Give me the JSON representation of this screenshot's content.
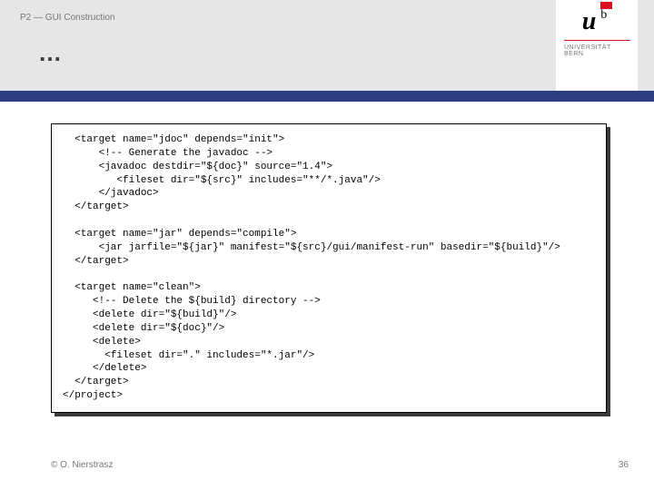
{
  "header": {
    "breadcrumb": "P2 — GUI Construction",
    "title": "…"
  },
  "logo": {
    "u": "u",
    "b": "b",
    "line1": "UNIVERSITÄT",
    "line2": "BERN"
  },
  "code": {
    "text": "  <target name=\"jdoc\" depends=\"init\">\n      <!-- Generate the javadoc -->\n      <javadoc destdir=\"${doc}\" source=\"1.4\">\n         <fileset dir=\"${src}\" includes=\"**/*.java\"/>\n      </javadoc>\n  </target>\n\n  <target name=\"jar\" depends=\"compile\">\n      <jar jarfile=\"${jar}\" manifest=\"${src}/gui/manifest-run\" basedir=\"${build}\"/>\n  </target>\n\n  <target name=\"clean\">\n     <!-- Delete the ${build} directory -->\n     <delete dir=\"${build}\"/>\n     <delete dir=\"${doc}\"/>\n     <delete>\n       <fileset dir=\".\" includes=\"*.jar\"/>\n     </delete>\n  </target>\n</project>"
  },
  "footer": {
    "copyright": "© O. Nierstrasz",
    "page": "36"
  }
}
